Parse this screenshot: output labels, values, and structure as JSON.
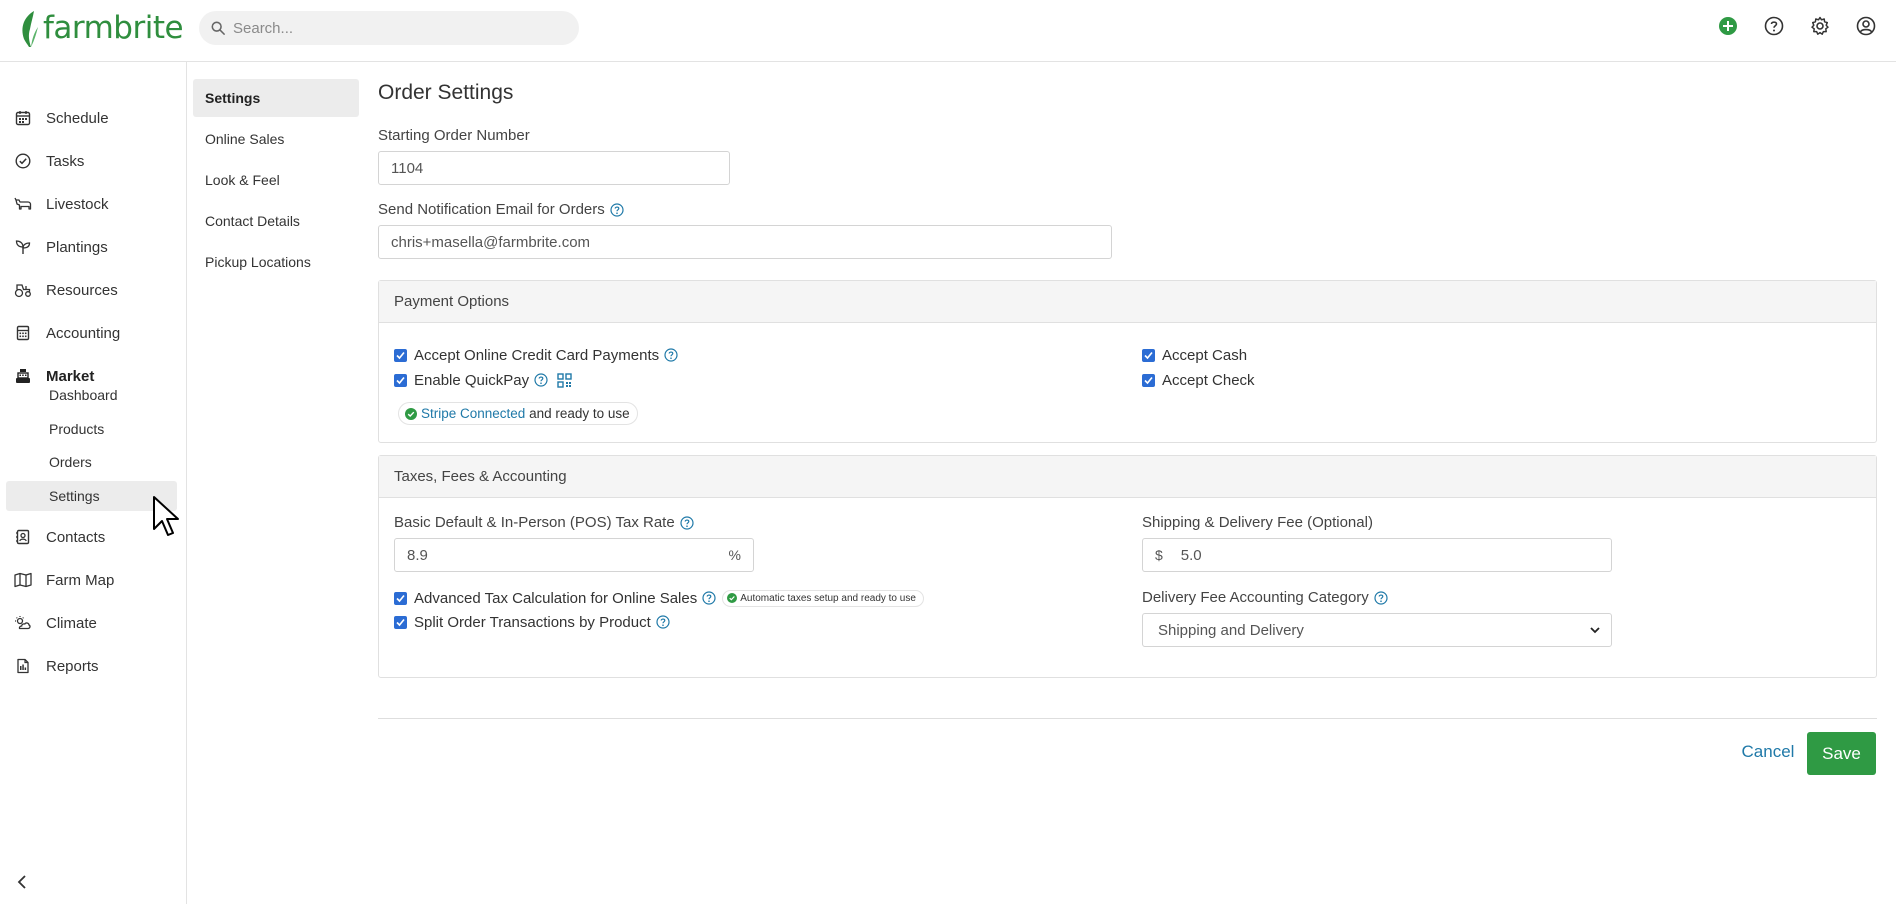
{
  "brand": {
    "name": "farmbrite",
    "color": "#2f8e3e"
  },
  "search": {
    "placeholder": "Search..."
  },
  "top_icons": [
    "add-circle-icon",
    "help-icon",
    "gear-icon",
    "user-icon"
  ],
  "sidebar": {
    "items": [
      {
        "label": "Schedule",
        "icon": "calendar-icon"
      },
      {
        "label": "Tasks",
        "icon": "check-circle-icon"
      },
      {
        "label": "Livestock",
        "icon": "cow-icon"
      },
      {
        "label": "Plantings",
        "icon": "sprout-icon"
      },
      {
        "label": "Resources",
        "icon": "tractor-icon"
      },
      {
        "label": "Accounting",
        "icon": "calculator-icon"
      },
      {
        "label": "Market",
        "icon": "register-icon"
      },
      {
        "label": "Contacts",
        "icon": "address-book-icon"
      },
      {
        "label": "Farm Map",
        "icon": "map-icon"
      },
      {
        "label": "Climate",
        "icon": "cloud-sun-icon"
      },
      {
        "label": "Reports",
        "icon": "report-icon"
      }
    ],
    "market_sub": [
      {
        "label": "Dashboard"
      },
      {
        "label": "Products"
      },
      {
        "label": "Orders"
      },
      {
        "label": "Settings",
        "active": true
      }
    ]
  },
  "subnav": [
    {
      "label": "Settings",
      "active": true
    },
    {
      "label": "Online Sales"
    },
    {
      "label": "Look & Feel"
    },
    {
      "label": "Contact Details"
    },
    {
      "label": "Pickup Locations"
    }
  ],
  "page": {
    "title": "Order Settings",
    "starting_order_label": "Starting Order Number",
    "starting_order_value": "1104",
    "notify_label": "Send Notification Email for Orders",
    "notify_value": "chris+masella@farmbrite.com"
  },
  "payment": {
    "heading": "Payment Options",
    "credit_card": "Accept Online Credit Card Payments",
    "quickpay": "Enable QuickPay",
    "stripe_link": "Stripe Connected",
    "stripe_suffix": " and ready to use",
    "cash": "Accept Cash",
    "check": "Accept Check"
  },
  "taxes": {
    "heading": "Taxes, Fees & Accounting",
    "tax_rate_label": "Basic Default & In-Person (POS) Tax Rate",
    "tax_rate_value": "8.9",
    "tax_rate_unit": "%",
    "advanced_tax": "Advanced Tax Calculation for Online Sales",
    "auto_taxes_badge": "Automatic taxes setup and ready to use",
    "split_order": "Split Order Transactions by Product",
    "shipping_label": "Shipping & Delivery Fee (Optional)",
    "shipping_currency": "$",
    "shipping_value": "5.0",
    "delivery_cat_label": "Delivery Fee Accounting Category",
    "delivery_cat_value": "Shipping and Delivery"
  },
  "actions": {
    "cancel": "Cancel",
    "save": "Save"
  },
  "colors": {
    "accent": "#2f9a44",
    "link": "#1f79a8",
    "checkbox": "#2b6cd4",
    "help": "#1f79a8"
  }
}
